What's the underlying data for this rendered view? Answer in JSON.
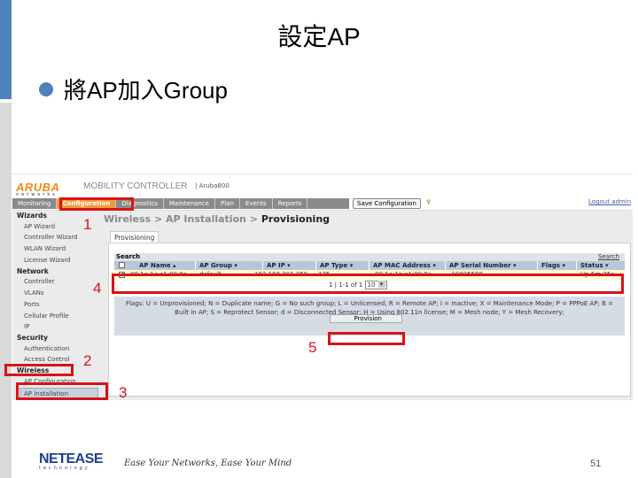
{
  "slide": {
    "title": "設定AP",
    "bullet": "將AP加入Group",
    "page_number": "51",
    "footer_brand": "NETEASE",
    "footer_brand_sub": "technology",
    "footer_slogan": "Ease Your Networks, Ease Your Mind"
  },
  "app": {
    "logo": "ARUBA",
    "logo_sub": "networks",
    "product_title": "MOBILITY CONTROLLER",
    "host": "| Aruba800",
    "nav": [
      {
        "label": "Monitoring",
        "active": false
      },
      {
        "label": "Configuration",
        "active": true
      },
      {
        "label": "Diagnostics",
        "active": false
      },
      {
        "label": "Maintenance",
        "active": false
      },
      {
        "label": "Plan",
        "active": false
      },
      {
        "label": "Events",
        "active": false
      },
      {
        "label": "Reports",
        "active": false
      }
    ],
    "save_button": "Save Configuration",
    "logout": "Logout admin"
  },
  "sidebar": {
    "groups": [
      {
        "label": "Wizards",
        "items": [
          "AP Wizard",
          "Controller Wizard",
          "WLAN Wizard",
          "License Wizard"
        ]
      },
      {
        "label": "Network",
        "items": [
          "Controller",
          "VLANs",
          "Ports",
          "Cellular Profile",
          "IP"
        ]
      },
      {
        "label": "Security",
        "items": [
          "Authentication",
          "Access Control"
        ]
      },
      {
        "label": "Wireless",
        "items": [
          "AP Configuration",
          "AP Installation"
        ]
      }
    ],
    "selected": "AP Installation"
  },
  "main": {
    "breadcrumb": {
      "part1": "Wireless",
      "sep": " > ",
      "part2": "AP Installation",
      "current": "Provisioning"
    },
    "tab": "Provisioning",
    "search_label": "Search",
    "search_link": "Search",
    "columns": [
      "AP Name ▴",
      "AP Group ▾",
      "AP IP ▾",
      "AP Type ▾",
      "AP MAC Address ▾",
      "AP Serial Number ▾",
      "Flags ▾",
      "Status ▾"
    ],
    "rows": [
      {
        "checked": true,
        "ap_name": "00:1a:1e:c1:00:9c",
        "ap_group": "default",
        "ap_ip": "192.168.201.250",
        "ap_type": "125",
        "ap_mac": "00:1a:1e:c1:00:9c",
        "serial": "A0005598",
        "flags": "",
        "status": "Up 6m:35s"
      }
    ],
    "pager": {
      "text": "1 | 1-1 of 1",
      "page_size": "10"
    },
    "flags_legend_1": "Flags: U = Unprovisioned; N = Duplicate name; G = No such group; L = Unlicensed; R = Remote AP; I = Inactive; X = Maintenance Mode; P = PPPoE AP; B =",
    "flags_legend_2": "Built in AP; S = Reprotect Sensor; d = Disconnected Sensor; H = Using 802.11n license; M = Mesh node; Y = Mesh Recovery;",
    "provision_button": "Provision"
  },
  "annotations": [
    "1",
    "2",
    "3",
    "4",
    "5"
  ],
  "colors": {
    "accent_blue": "#4f81bd",
    "annotation_red": "#d7141a",
    "aruba_orange": "#f08a1c",
    "row_highlight": "#fdfbd6"
  }
}
